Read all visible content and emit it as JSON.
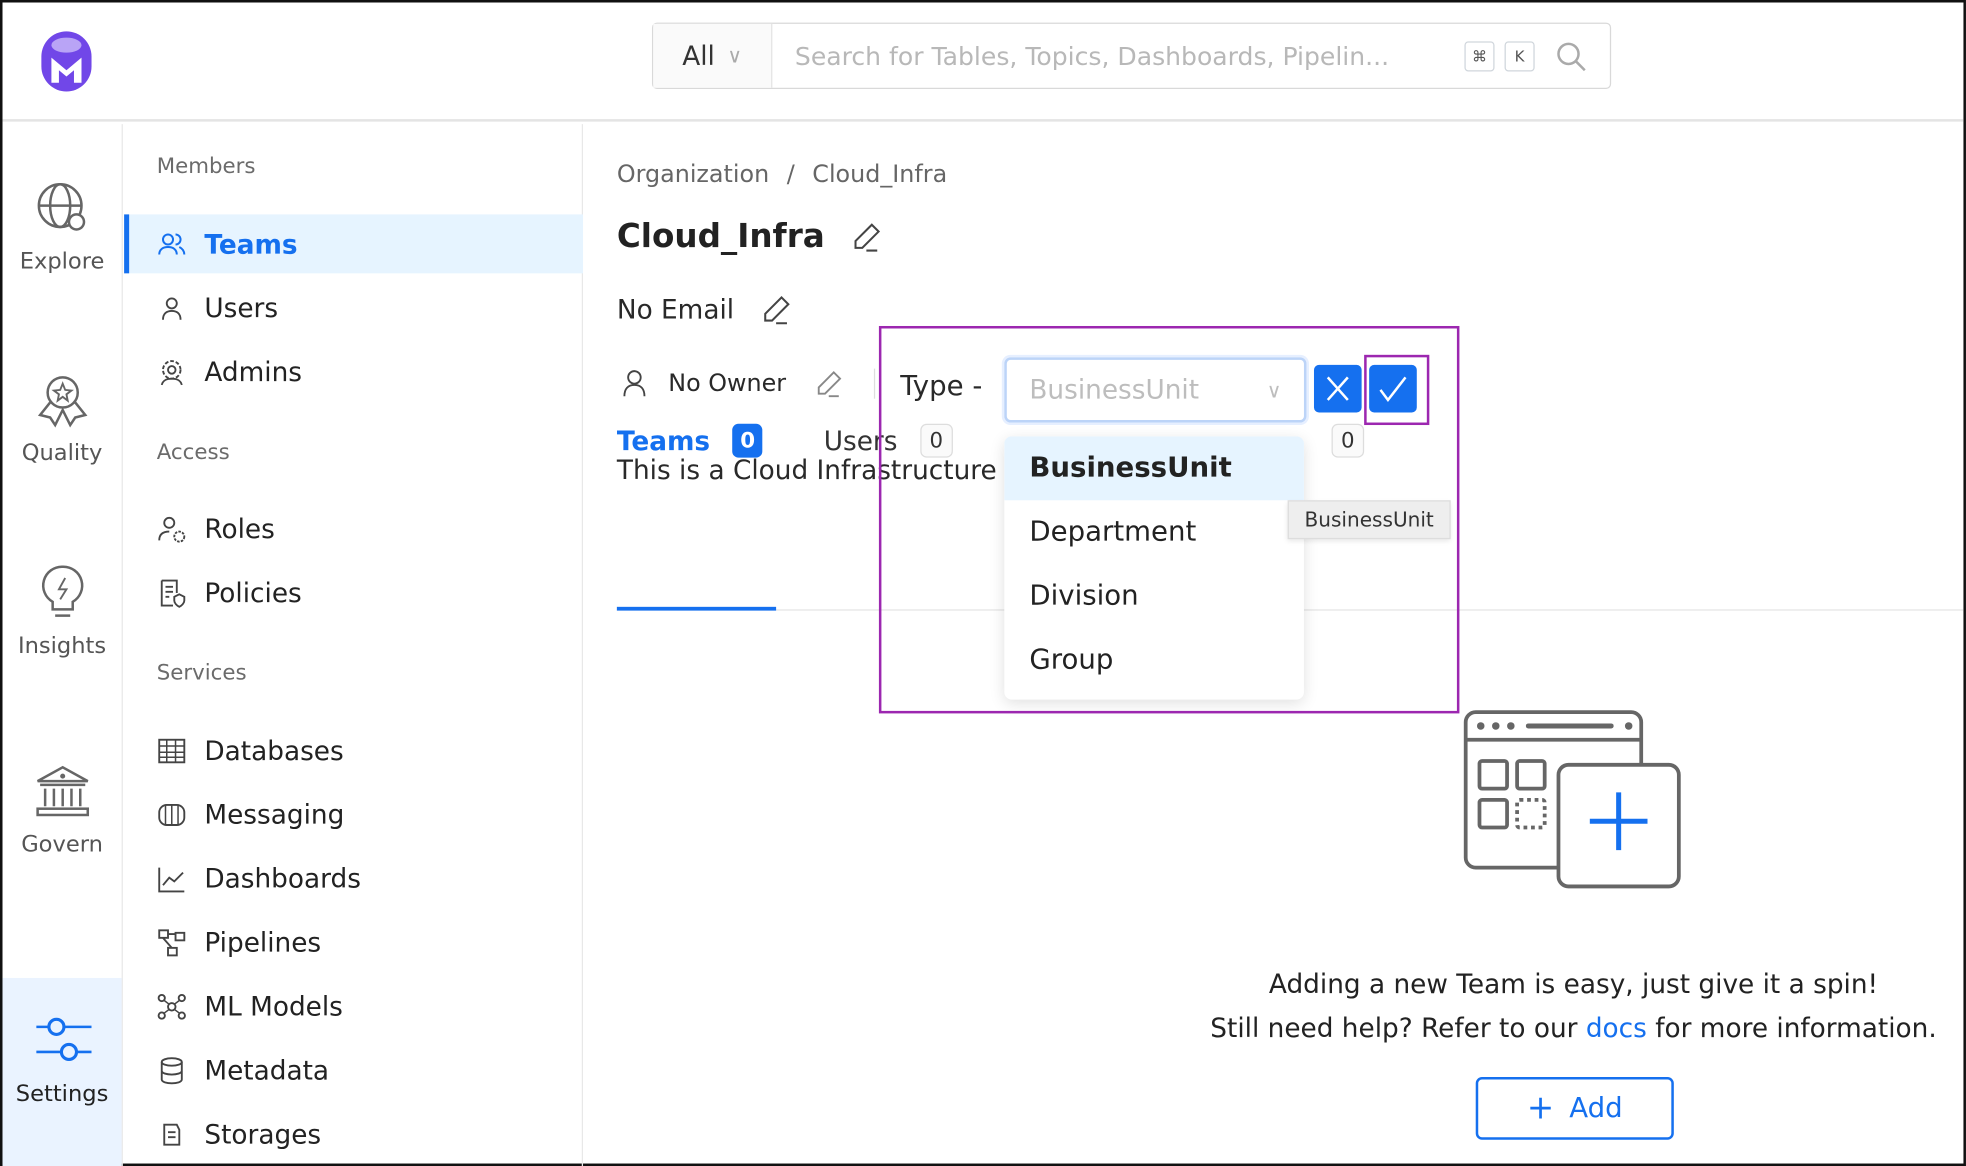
{
  "header": {
    "search_scope": "All",
    "search_placeholder": "Search for Tables, Topics, Dashboards, Pipelin...",
    "shortcut_keys": [
      "⌘",
      "K"
    ]
  },
  "rail": [
    {
      "label": "Explore",
      "icon": "globe-search-icon"
    },
    {
      "label": "Quality",
      "icon": "award-icon"
    },
    {
      "label": "Insights",
      "icon": "lightbulb-icon"
    },
    {
      "label": "Govern",
      "icon": "bank-icon"
    },
    {
      "label": "Settings",
      "icon": "sliders-icon",
      "active": true
    }
  ],
  "sidebar": {
    "sections": [
      "Members",
      "Access",
      "Services"
    ],
    "members": [
      "Teams",
      "Users",
      "Admins"
    ],
    "access": [
      "Roles",
      "Policies"
    ],
    "services": [
      "Databases",
      "Messaging",
      "Dashboards",
      "Pipelines",
      "ML Models",
      "Metadata",
      "Storages"
    ]
  },
  "main": {
    "breadcrumb": [
      "Organization",
      "Cloud_Infra"
    ],
    "breadcrumb_sep": "/",
    "title": "Cloud_Infra",
    "email": "No Email",
    "owner": "No Owner",
    "type_label": "Type -",
    "type_value": "BusinessUnit",
    "description": "This is a Cloud Infrastructure",
    "tabs": [
      {
        "label": "Teams",
        "count": "0",
        "active": true
      },
      {
        "label": "Users",
        "count": "0"
      },
      {
        "label": "",
        "count": "0"
      }
    ],
    "type_options": [
      "BusinessUnit",
      "Department",
      "Division",
      "Group"
    ],
    "tooltip": "BusinessUnit",
    "empty_line1": "Adding a new Team is easy, just give it a spin!",
    "empty_line2_pre": "Still need help? Refer to our ",
    "empty_link": "docs",
    "empty_line2_post": " for more information.",
    "add_label": "Add"
  },
  "colors": {
    "accent": "#1570ef",
    "highlight": "#9c27b0",
    "brand": "#7147e8"
  }
}
